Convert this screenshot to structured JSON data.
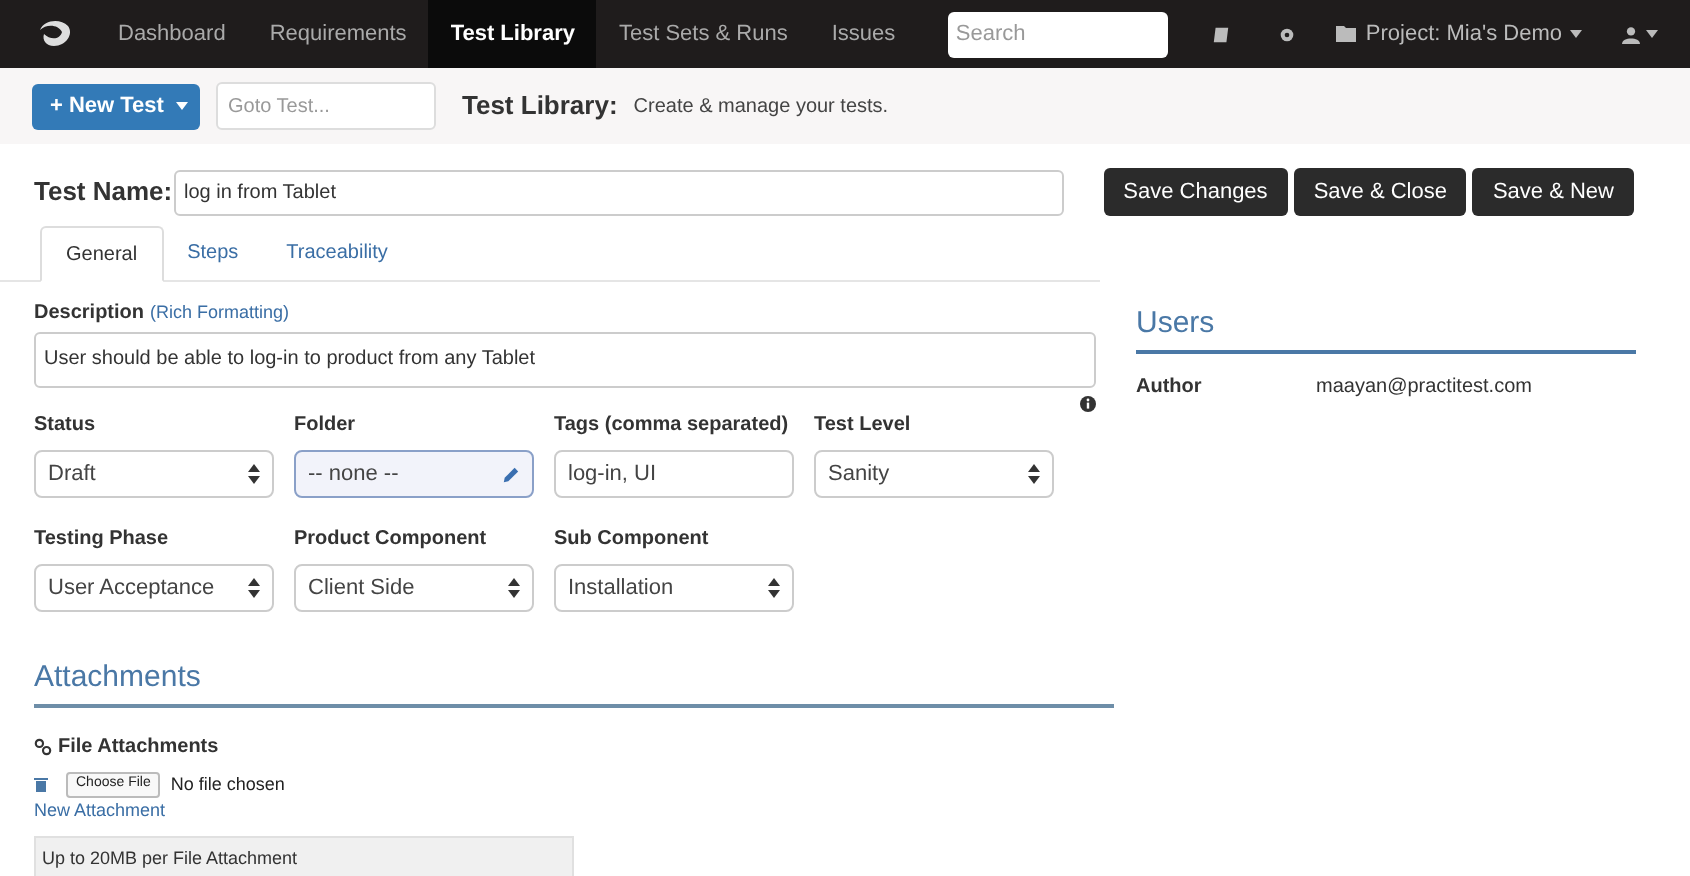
{
  "nav": {
    "items": [
      {
        "label": "Dashboard",
        "selected": false
      },
      {
        "label": "Requirements",
        "selected": false
      },
      {
        "label": "Test Library",
        "selected": true
      },
      {
        "label": "Test Sets & Runs",
        "selected": false
      },
      {
        "label": "Issues",
        "selected": false
      }
    ],
    "search": {
      "placeholder": "Search"
    },
    "project": "Project: Mia's Demo"
  },
  "toolbar": {
    "new_button": "+ New Test",
    "goto": {
      "placeholder": "Goto Test..."
    },
    "title": "Test Library:",
    "subtitle": "Create & manage your tests."
  },
  "test_name": {
    "label": "Test Name:",
    "value": "log in from Tablet"
  },
  "actions": [
    "Save Changes",
    "Save & Close",
    "Save & New"
  ],
  "tabs": [
    {
      "label": "General",
      "selected": true
    },
    {
      "label": "Steps",
      "selected": false
    },
    {
      "label": "Traceability",
      "selected": false
    }
  ],
  "description": {
    "label": "Description",
    "link": "(Rich Formatting)",
    "value": "User should be able to log-in to product from any Tablet"
  },
  "field_rows": [
    [
      {
        "label": "Status",
        "kind": "select",
        "value": "Draft"
      },
      {
        "label": "Folder",
        "kind": "folder",
        "value": "-- none --"
      },
      {
        "label": "Tags (comma separated)",
        "kind": "input",
        "value": "log-in, UI"
      },
      {
        "label": "Test Level",
        "kind": "select",
        "value": "Sanity"
      }
    ],
    [
      {
        "label": "Testing Phase",
        "kind": "select",
        "value": "User Acceptance"
      },
      {
        "label": "Product Component",
        "kind": "select",
        "value": "Client Side"
      },
      {
        "label": "Sub Component",
        "kind": "select",
        "value": "Installation"
      }
    ]
  ],
  "users": {
    "title": "Users",
    "rows": [
      {
        "label": "Author",
        "value": "maayan@practitest.com"
      }
    ]
  },
  "attachments": {
    "title": "Attachments",
    "subtitle": "File Attachments",
    "choose": "Choose File",
    "status": "No file chosen",
    "link": "New Attachment",
    "note": "Up to 20MB per File Attachment"
  }
}
